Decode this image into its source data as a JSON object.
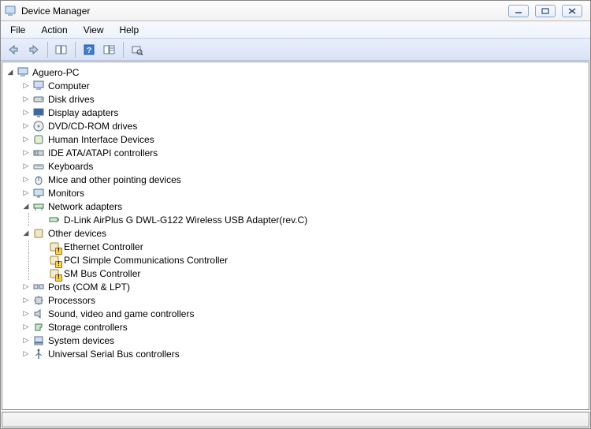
{
  "window": {
    "title": "Device Manager"
  },
  "menu": {
    "file": "File",
    "action": "Action",
    "view": "View",
    "help": "Help"
  },
  "tree": {
    "root": {
      "label": "Aguero-PC"
    },
    "items": [
      {
        "label": "Computer",
        "icon": "computer",
        "expanded": false
      },
      {
        "label": "Disk drives",
        "icon": "disk",
        "expanded": false
      },
      {
        "label": "Display adapters",
        "icon": "display",
        "expanded": false
      },
      {
        "label": "DVD/CD-ROM drives",
        "icon": "cdrom",
        "expanded": false
      },
      {
        "label": "Human Interface Devices",
        "icon": "hid",
        "expanded": false
      },
      {
        "label": "IDE ATA/ATAPI controllers",
        "icon": "ide",
        "expanded": false
      },
      {
        "label": "Keyboards",
        "icon": "keyboard",
        "expanded": false
      },
      {
        "label": "Mice and other pointing devices",
        "icon": "mouse",
        "expanded": false
      },
      {
        "label": "Monitors",
        "icon": "monitor",
        "expanded": false
      },
      {
        "label": "Network adapters",
        "icon": "network",
        "expanded": true,
        "children": [
          {
            "label": "D-Link AirPlus G DWL-G122 Wireless USB Adapter(rev.C)",
            "icon": "adapter"
          }
        ]
      },
      {
        "label": "Other devices",
        "icon": "other",
        "expanded": true,
        "children": [
          {
            "label": "Ethernet Controller",
            "icon": "unknown",
            "warn": true
          },
          {
            "label": "PCI Simple Communications Controller",
            "icon": "unknown",
            "warn": true
          },
          {
            "label": "SM Bus Controller",
            "icon": "unknown",
            "warn": true
          }
        ]
      },
      {
        "label": "Ports (COM & LPT)",
        "icon": "ports",
        "expanded": false
      },
      {
        "label": "Processors",
        "icon": "cpu",
        "expanded": false
      },
      {
        "label": "Sound, video and game controllers",
        "icon": "sound",
        "expanded": false
      },
      {
        "label": "Storage controllers",
        "icon": "storage",
        "expanded": false
      },
      {
        "label": "System devices",
        "icon": "system",
        "expanded": false
      },
      {
        "label": "Universal Serial Bus controllers",
        "icon": "usb",
        "expanded": false
      }
    ]
  }
}
